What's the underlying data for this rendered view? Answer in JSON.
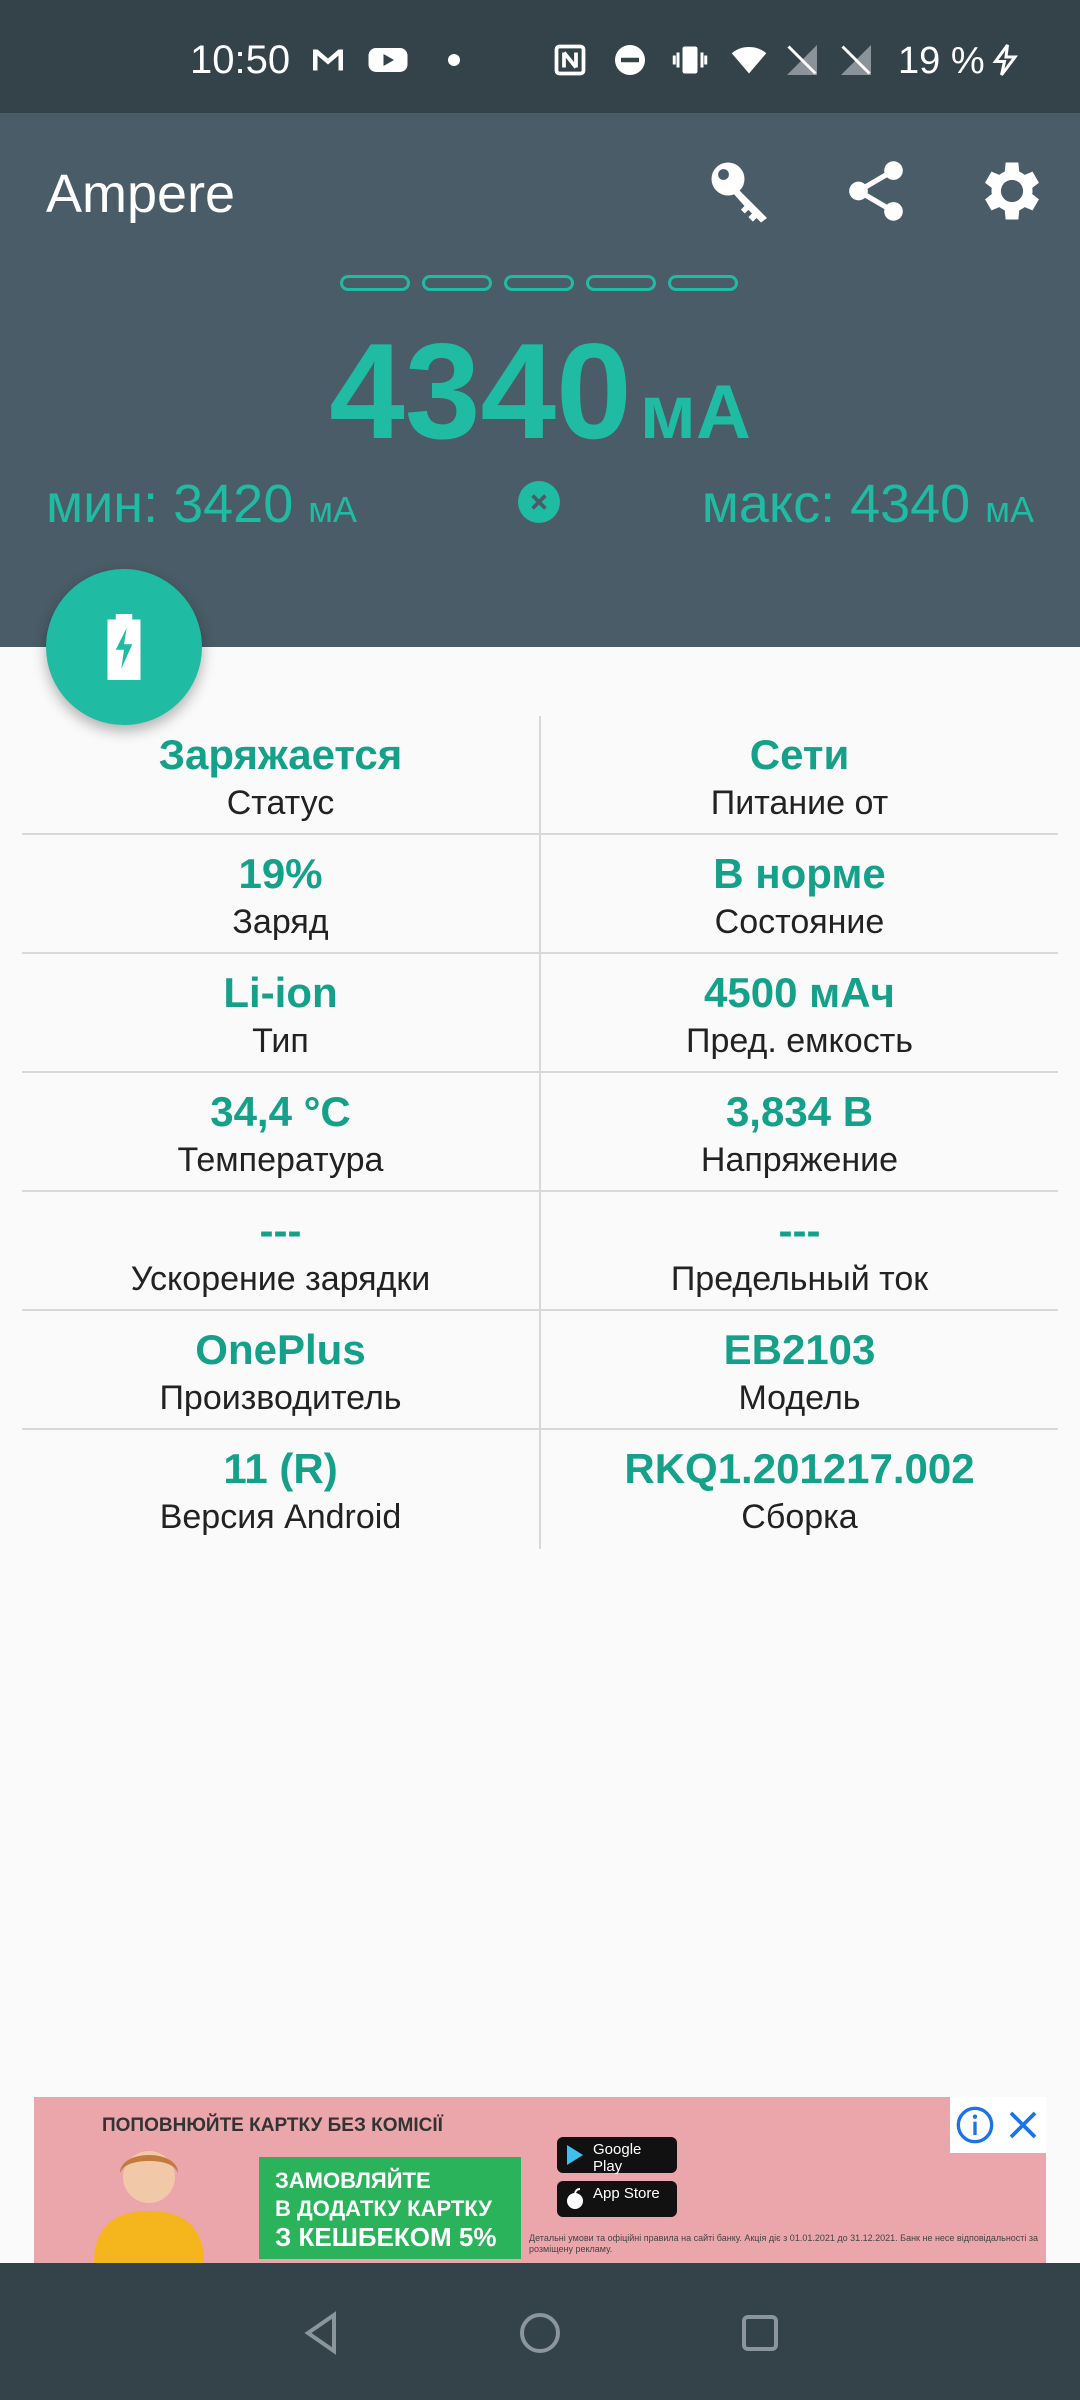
{
  "status_bar": {
    "time": "10:50",
    "battery_text": "19 %",
    "icons": [
      "gmail-icon",
      "youtube-icon",
      "dot-icon",
      "nfc-icon",
      "dnd-icon",
      "vibrate-icon",
      "wifi-icon",
      "no-signal-icon",
      "no-signal-icon",
      "charging-icon"
    ]
  },
  "header": {
    "title": "Ampere",
    "actions": [
      "key-icon",
      "share-icon",
      "settings-icon"
    ],
    "current_value": "4340",
    "current_unit": "мА",
    "min_label": "мин: 3420",
    "max_label": "макс: 4340",
    "min_max_unit": "мА"
  },
  "fab_icon": "battery-charging-icon",
  "info": {
    "rows": [
      [
        {
          "value": "Заряжается",
          "label": "Статус"
        },
        {
          "value": "Сети",
          "label": "Питание от"
        }
      ],
      [
        {
          "value": "19%",
          "label": "Заряд"
        },
        {
          "value": "В норме",
          "label": "Состояние"
        }
      ],
      [
        {
          "value": "Li-ion",
          "label": "Тип"
        },
        {
          "value": "4500 мАч",
          "label": "Пред. емкость"
        }
      ],
      [
        {
          "value": "34,4 °C",
          "label": "Температура"
        },
        {
          "value": "3,834 В",
          "label": "Напряжение"
        }
      ],
      [
        {
          "value": "---",
          "label": "Ускорение зарядки"
        },
        {
          "value": "---",
          "label": "Предельный ток"
        }
      ],
      [
        {
          "value": "OnePlus",
          "label": "Производитель"
        },
        {
          "value": "EB2103",
          "label": "Модель"
        }
      ],
      [
        {
          "value": "11 (R)",
          "label": "Версия Android"
        },
        {
          "value": "RKQ1.201217.002",
          "label": "Сборка"
        }
      ]
    ]
  },
  "ad": {
    "headline": "ПОПОВНЮЙТЕ КАРТКУ БЕЗ КОМІСІЇ",
    "cta_line1": "ЗАМОВЛЯЙТЕ",
    "cta_line2": "В ДОДАТКУ КАРТКУ",
    "cta_line3": "З КЕШБЕКОМ 5%",
    "store1": "Google Play",
    "store2": "App Store",
    "fine_print": "Детальні умови та офіційні правила на сайті банку. Акція діє з 01.01.2021 до 31.12.2021. Банк не несе відповідальності за розміщену рекламу."
  },
  "colors": {
    "accent": "#1fbba2",
    "value_text": "#15a08a",
    "header_bg": "#4a5c67",
    "status_bg": "#34424a"
  }
}
